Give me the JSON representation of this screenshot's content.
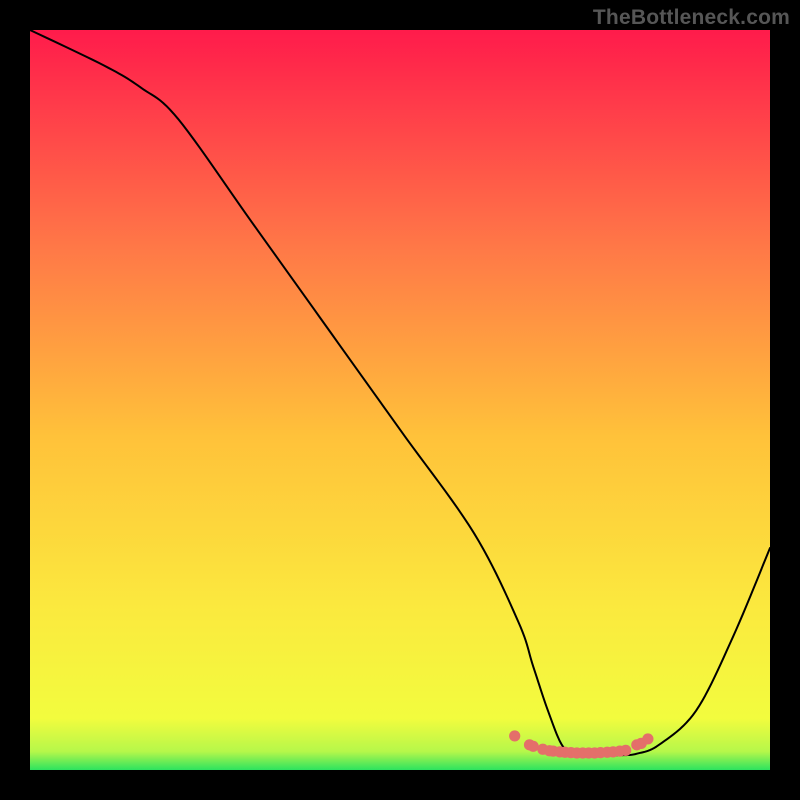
{
  "attribution": "TheBottleneck.com",
  "colors": {
    "background": "#000000",
    "attribution_text": "#565656",
    "line": "#000000",
    "marker": "#e46f6a",
    "gradient_top": "#ff1b4b",
    "gradient_mid_upper": "#ff8a3b",
    "gradient_mid": "#ffd23a",
    "gradient_lower": "#fef33e",
    "gradient_bottom": "#2ce35f"
  },
  "chart_data": {
    "type": "line",
    "title": "",
    "xlabel": "",
    "ylabel": "",
    "xlim": [
      0,
      100
    ],
    "ylim": [
      0,
      100
    ],
    "grid": false,
    "series": [
      {
        "name": "curve",
        "x": [
          0,
          10,
          15,
          20,
          30,
          40,
          50,
          60,
          66,
          68,
          70,
          72,
          74,
          76,
          78,
          80,
          82,
          85,
          90,
          95,
          100
        ],
        "values": [
          100,
          95.2,
          92.2,
          88,
          74,
          60,
          46,
          32,
          20,
          14,
          8,
          3.2,
          2.2,
          2.0,
          2.0,
          2.0,
          2.2,
          3.4,
          8,
          18,
          30
        ]
      }
    ],
    "markers": {
      "name": "bottom-markers",
      "x": [
        65.5,
        67.5,
        68.0,
        69.3,
        70.2,
        70.7,
        71.6,
        72.3,
        73.1,
        73.9,
        74.7,
        75.5,
        76.3,
        77.1,
        78.0,
        78.8,
        79.7,
        80.5,
        82.0,
        82.6,
        83.5
      ],
      "values": [
        4.6,
        3.4,
        3.2,
        2.8,
        2.6,
        2.55,
        2.45,
        2.4,
        2.35,
        2.3,
        2.3,
        2.3,
        2.3,
        2.35,
        2.4,
        2.45,
        2.55,
        2.65,
        3.4,
        3.6,
        4.2
      ]
    }
  }
}
